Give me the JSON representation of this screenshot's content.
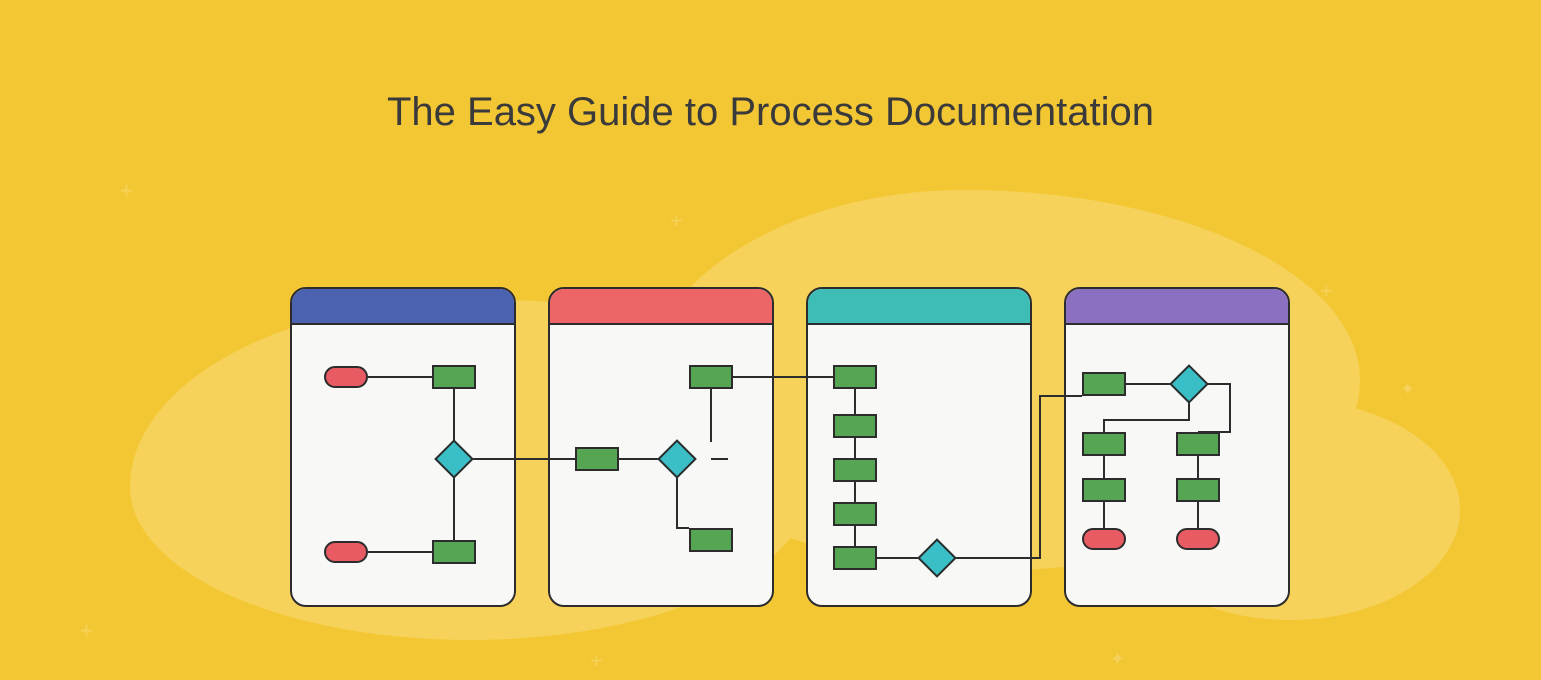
{
  "title": "The Easy Guide to Process Documentation",
  "colors": {
    "background": "#f3c734",
    "blob": "#f6d25a",
    "panel_bg": "#f8f8f7",
    "stroke": "#2c2c2c",
    "process": "#55a552",
    "terminator": "#e85b63",
    "decision": "#3bbfc7",
    "header_blue": "#4b62b0",
    "header_red": "#ed6566",
    "header_teal": "#3dbdb6",
    "header_purple": "#8b6fc1"
  },
  "panels": [
    {
      "id": "panel-1",
      "header_color_key": "header_blue"
    },
    {
      "id": "panel-2",
      "header_color_key": "header_red"
    },
    {
      "id": "panel-3",
      "header_color_key": "header_teal"
    },
    {
      "id": "panel-4",
      "header_color_key": "header_purple"
    }
  ],
  "shapes": [
    {
      "id": "t1a",
      "panel": 1,
      "type": "terminator"
    },
    {
      "id": "r1a",
      "panel": 1,
      "type": "process"
    },
    {
      "id": "d1",
      "panel": 1,
      "type": "decision"
    },
    {
      "id": "t1b",
      "panel": 1,
      "type": "terminator"
    },
    {
      "id": "r1b",
      "panel": 1,
      "type": "process"
    },
    {
      "id": "r2a",
      "panel": 2,
      "type": "process"
    },
    {
      "id": "r2b",
      "panel": 2,
      "type": "process"
    },
    {
      "id": "d2",
      "panel": 2,
      "type": "decision"
    },
    {
      "id": "r2c",
      "panel": 2,
      "type": "process"
    },
    {
      "id": "r3a",
      "panel": 3,
      "type": "process"
    },
    {
      "id": "r3b",
      "panel": 3,
      "type": "process"
    },
    {
      "id": "r3c",
      "panel": 3,
      "type": "process"
    },
    {
      "id": "r3d",
      "panel": 3,
      "type": "process"
    },
    {
      "id": "r3e",
      "panel": 3,
      "type": "process"
    },
    {
      "id": "d3",
      "panel": 3,
      "type": "decision"
    },
    {
      "id": "r4a",
      "panel": 4,
      "type": "process"
    },
    {
      "id": "d4",
      "panel": 4,
      "type": "decision"
    },
    {
      "id": "r4b",
      "panel": 4,
      "type": "process"
    },
    {
      "id": "r4c",
      "panel": 4,
      "type": "process"
    },
    {
      "id": "r4d",
      "panel": 4,
      "type": "process"
    },
    {
      "id": "r4e",
      "panel": 4,
      "type": "process"
    },
    {
      "id": "t4a",
      "panel": 4,
      "type": "terminator"
    },
    {
      "id": "t4b",
      "panel": 4,
      "type": "terminator"
    }
  ],
  "connections": [
    [
      "t1a",
      "r1a"
    ],
    [
      "r1a",
      "d1"
    ],
    [
      "d1",
      "r1b"
    ],
    [
      "r1b",
      "t1b"
    ],
    [
      "d1",
      "r2b"
    ],
    [
      "r2a",
      "d2"
    ],
    [
      "r2b",
      "d2"
    ],
    [
      "d2",
      "r2c"
    ],
    [
      "r2a",
      "r3a"
    ],
    [
      "r3a",
      "r3b"
    ],
    [
      "r3b",
      "r3c"
    ],
    [
      "r3c",
      "r3d"
    ],
    [
      "r3d",
      "r3e"
    ],
    [
      "r3e",
      "d3"
    ],
    [
      "d3",
      "r4a"
    ],
    [
      "r4a",
      "d4"
    ],
    [
      "d4",
      "r4b"
    ],
    [
      "d4",
      "r4c"
    ],
    [
      "r4b",
      "r4d"
    ],
    [
      "r4d",
      "t4a"
    ],
    [
      "r4c",
      "r4e"
    ],
    [
      "r4e",
      "t4b"
    ]
  ]
}
